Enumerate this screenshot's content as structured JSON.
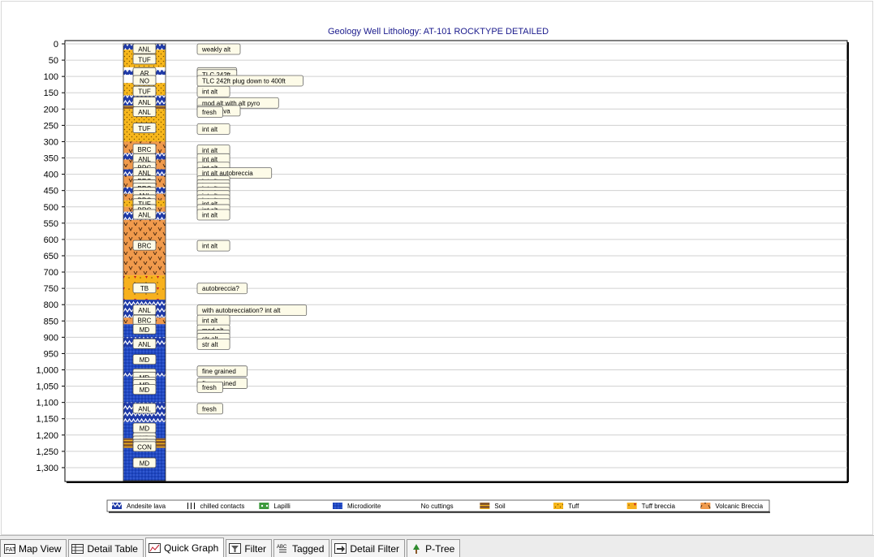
{
  "chart_data": {
    "type": "well-lithology-log",
    "title": "Geology Well Lithology:  AT-101 ROCKTYPE DETAILED",
    "ylim": [
      0,
      1340
    ],
    "y_reversed": true,
    "y_ticks": [
      0,
      50,
      100,
      150,
      200,
      250,
      300,
      350,
      400,
      450,
      500,
      550,
      600,
      650,
      700,
      750,
      800,
      850,
      900,
      950,
      1000,
      1050,
      1100,
      1150,
      1200,
      1250,
      1300
    ],
    "y_tick_labels": [
      "0",
      "50",
      "100",
      "150",
      "200",
      "250",
      "300",
      "350",
      "400",
      "450",
      "500",
      "550",
      "600",
      "650",
      "700",
      "750",
      "800",
      "850",
      "900",
      "950",
      "1,000",
      "1,050",
      "1,100",
      "1,150",
      "1,200",
      "1,250",
      "1,300"
    ],
    "grid": true,
    "colors": {
      "andesite": "#1f3aa8",
      "tuff": "#f7b71c",
      "tuff_breccia": "#f2a12b",
      "volcanic_breccia": "#f09a4c",
      "microdiorite": "#2048c4",
      "soil": "#8a5a2b"
    },
    "intervals": [
      {
        "from": 0,
        "to": 18,
        "rock": "andesite",
        "code": "ANL"
      },
      {
        "from": 18,
        "to": 72,
        "rock": "tuff",
        "code": "TUF"
      },
      {
        "from": 72,
        "to": 80,
        "rock": "none",
        "code": "NO"
      },
      {
        "from": 80,
        "to": 95,
        "rock": "andesite",
        "code": "ANL"
      },
      {
        "from": 95,
        "to": 120,
        "rock": "none",
        "code": "NO"
      },
      {
        "from": 120,
        "to": 158,
        "rock": "tuff",
        "code": "TUF"
      },
      {
        "from": 158,
        "to": 190,
        "rock": "andesite",
        "code": "ANL"
      },
      {
        "from": 190,
        "to": 202,
        "rock": "soil",
        "code": "ANL"
      },
      {
        "from": 202,
        "to": 300,
        "rock": "tuff",
        "code": "TUF"
      },
      {
        "from": 300,
        "to": 335,
        "rock": "volcanic_breccia",
        "code": "BRC"
      },
      {
        "from": 335,
        "to": 355,
        "rock": "andesite",
        "code": "ANL"
      },
      {
        "from": 355,
        "to": 385,
        "rock": "volcanic_breccia",
        "code": "BRC"
      },
      {
        "from": 385,
        "to": 405,
        "rock": "andesite",
        "code": "ANL"
      },
      {
        "from": 405,
        "to": 440,
        "rock": "volcanic_breccia",
        "code": "BRC"
      },
      {
        "from": 440,
        "to": 460,
        "rock": "andesite",
        "code": "ANL"
      },
      {
        "from": 460,
        "to": 480,
        "rock": "volcanic_breccia",
        "code": "BRC"
      },
      {
        "from": 480,
        "to": 500,
        "rock": "tuff",
        "code": "TUF"
      },
      {
        "from": 500,
        "to": 515,
        "rock": "volcanic_breccia",
        "code": "BRC"
      },
      {
        "from": 515,
        "to": 540,
        "rock": "andesite",
        "code": "ANL"
      },
      {
        "from": 540,
        "to": 710,
        "rock": "volcanic_breccia",
        "code": "BRC"
      },
      {
        "from": 710,
        "to": 785,
        "rock": "tuff_breccia",
        "code": "TB"
      },
      {
        "from": 785,
        "to": 840,
        "rock": "andesite",
        "code": "ANL"
      },
      {
        "from": 840,
        "to": 860,
        "rock": "volcanic_breccia",
        "code": "BRC"
      },
      {
        "from": 860,
        "to": 900,
        "rock": "microdiorite",
        "code": "MD"
      },
      {
        "from": 900,
        "to": 930,
        "rock": "andesite",
        "code": "ANL"
      },
      {
        "from": 930,
        "to": 1005,
        "rock": "microdiorite",
        "code": "MD"
      },
      {
        "from": 1005,
        "to": 1020,
        "rock": "andesite",
        "code": "ANL"
      },
      {
        "from": 1020,
        "to": 1100,
        "rock": "microdiorite",
        "code": "MD"
      },
      {
        "from": 1100,
        "to": 1160,
        "rock": "andesite",
        "code": "ANL"
      },
      {
        "from": 1160,
        "to": 1210,
        "rock": "microdiorite",
        "code": "MD"
      },
      {
        "from": 1210,
        "to": 1240,
        "rock": "soil",
        "code": "CON"
      },
      {
        "from": 1240,
        "to": 1340,
        "rock": "microdiorite",
        "code": "MD"
      }
    ],
    "code_labels": [
      {
        "depth": 15,
        "code": "ANL"
      },
      {
        "depth": 47,
        "code": "TUF"
      },
      {
        "depth": 88,
        "code": "AR"
      },
      {
        "depth": 112,
        "code": "NO"
      },
      {
        "depth": 145,
        "code": "TUF"
      },
      {
        "depth": 178,
        "code": "ANL"
      },
      {
        "depth": 208,
        "code": "ANL"
      },
      {
        "depth": 258,
        "code": "TUF"
      },
      {
        "depth": 322,
        "code": "BRC"
      },
      {
        "depth": 352,
        "code": "ANL"
      },
      {
        "depth": 378,
        "code": "BRC"
      },
      {
        "depth": 395,
        "code": "ANL"
      },
      {
        "depth": 420,
        "code": "BRC"
      },
      {
        "depth": 432,
        "code": "ANL"
      },
      {
        "depth": 442,
        "code": "BRC"
      },
      {
        "depth": 455,
        "code": "ANL"
      },
      {
        "depth": 465,
        "code": "ANL"
      },
      {
        "depth": 478,
        "code": "BRC"
      },
      {
        "depth": 490,
        "code": "TUF"
      },
      {
        "depth": 508,
        "code": "BRC"
      },
      {
        "depth": 523,
        "code": "ANL"
      },
      {
        "depth": 618,
        "code": "BRC"
      },
      {
        "depth": 749,
        "code": "TB"
      },
      {
        "depth": 816,
        "code": "ANL"
      },
      {
        "depth": 847,
        "code": "BRC"
      },
      {
        "depth": 875,
        "code": "MD"
      },
      {
        "depth": 920,
        "code": "ANL"
      },
      {
        "depth": 968,
        "code": "MD"
      },
      {
        "depth": 1012,
        "code": "ANL"
      },
      {
        "depth": 1022,
        "code": "MD"
      },
      {
        "depth": 1038,
        "code": "MD"
      },
      {
        "depth": 1045,
        "code": "MD"
      },
      {
        "depth": 1060,
        "code": "MD"
      },
      {
        "depth": 1118,
        "code": "ANL"
      },
      {
        "depth": 1178,
        "code": "MD"
      },
      {
        "depth": 1208,
        "code": "MD"
      },
      {
        "depth": 1218,
        "code": "MD"
      },
      {
        "depth": 1228,
        "code": "MD"
      },
      {
        "depth": 1235,
        "code": "CON"
      },
      {
        "depth": 1285,
        "code": "MD"
      }
    ],
    "comments": [
      {
        "depth": 15,
        "text": "weakly alt"
      },
      {
        "depth": 88,
        "text": "TLC 242ft"
      },
      {
        "depth": 94,
        "text": "TLC 242ft"
      },
      {
        "depth": 112,
        "text": "TLC 242ft plug down to 400ft"
      },
      {
        "depth": 145,
        "text": "int alt"
      },
      {
        "depth": 180,
        "text": "mod alt with alt pyro"
      },
      {
        "depth": 204,
        "text": "fresh lava"
      },
      {
        "depth": 208,
        "text": "fresh"
      },
      {
        "depth": 260,
        "text": "int alt"
      },
      {
        "depth": 325,
        "text": "int alt"
      },
      {
        "depth": 352,
        "text": "int alt"
      },
      {
        "depth": 378,
        "text": "int alt"
      },
      {
        "depth": 395,
        "text": "int alt autobreccia"
      },
      {
        "depth": 420,
        "text": "int alt"
      },
      {
        "depth": 432,
        "text": "int alt"
      },
      {
        "depth": 442,
        "text": "int alt"
      },
      {
        "depth": 455,
        "text": "int alt"
      },
      {
        "depth": 465,
        "text": "int alt"
      },
      {
        "depth": 478,
        "text": "int alt"
      },
      {
        "depth": 490,
        "text": "int alt"
      },
      {
        "depth": 508,
        "text": "int alt"
      },
      {
        "depth": 523,
        "text": "int alt"
      },
      {
        "depth": 618,
        "text": "int alt"
      },
      {
        "depth": 749,
        "text": "autobreccia?"
      },
      {
        "depth": 816,
        "text": "with autobrecciation? int alt"
      },
      {
        "depth": 847,
        "text": "int alt"
      },
      {
        "depth": 877,
        "text": "mod alt"
      },
      {
        "depth": 893,
        "text": "mod alt"
      },
      {
        "depth": 903,
        "text": "str alt"
      },
      {
        "depth": 920,
        "text": "str alt"
      },
      {
        "depth": 1003,
        "text": "fine grained"
      },
      {
        "depth": 1040,
        "text": "fine grained"
      },
      {
        "depth": 1052,
        "text": "fresh"
      },
      {
        "depth": 1118,
        "text": "fresh"
      }
    ],
    "legend": [
      {
        "name": "Andesite lava",
        "swatch": "andesite"
      },
      {
        "name": "chilled contacts",
        "swatch": "chilled"
      },
      {
        "name": "Lapilli",
        "swatch": "lapilli"
      },
      {
        "name": "Microdiorite",
        "swatch": "microdiorite"
      },
      {
        "name": "No cuttings",
        "swatch": "none"
      },
      {
        "name": "Soil",
        "swatch": "soil"
      },
      {
        "name": "Tuff",
        "swatch": "tuff"
      },
      {
        "name": "Tuff breccia",
        "swatch": "tuff_breccia"
      },
      {
        "name": "Volcanic Breccia",
        "swatch": "volcanic_breccia"
      }
    ],
    "legend_placement": "bottom"
  },
  "tabs": [
    {
      "label": "Map View",
      "icon": "map-icon",
      "active": false
    },
    {
      "label": "Detail Table",
      "icon": "table-icon",
      "active": false
    },
    {
      "label": "Quick Graph",
      "icon": "graph-icon",
      "active": true
    },
    {
      "label": "Filter",
      "icon": "filter-icon",
      "active": false
    },
    {
      "label": "Tagged",
      "icon": "tag-icon",
      "active": false
    },
    {
      "label": "Detail Filter",
      "icon": "detail-filter-icon",
      "active": false
    },
    {
      "label": "P-Tree",
      "icon": "tree-icon",
      "active": false
    }
  ]
}
